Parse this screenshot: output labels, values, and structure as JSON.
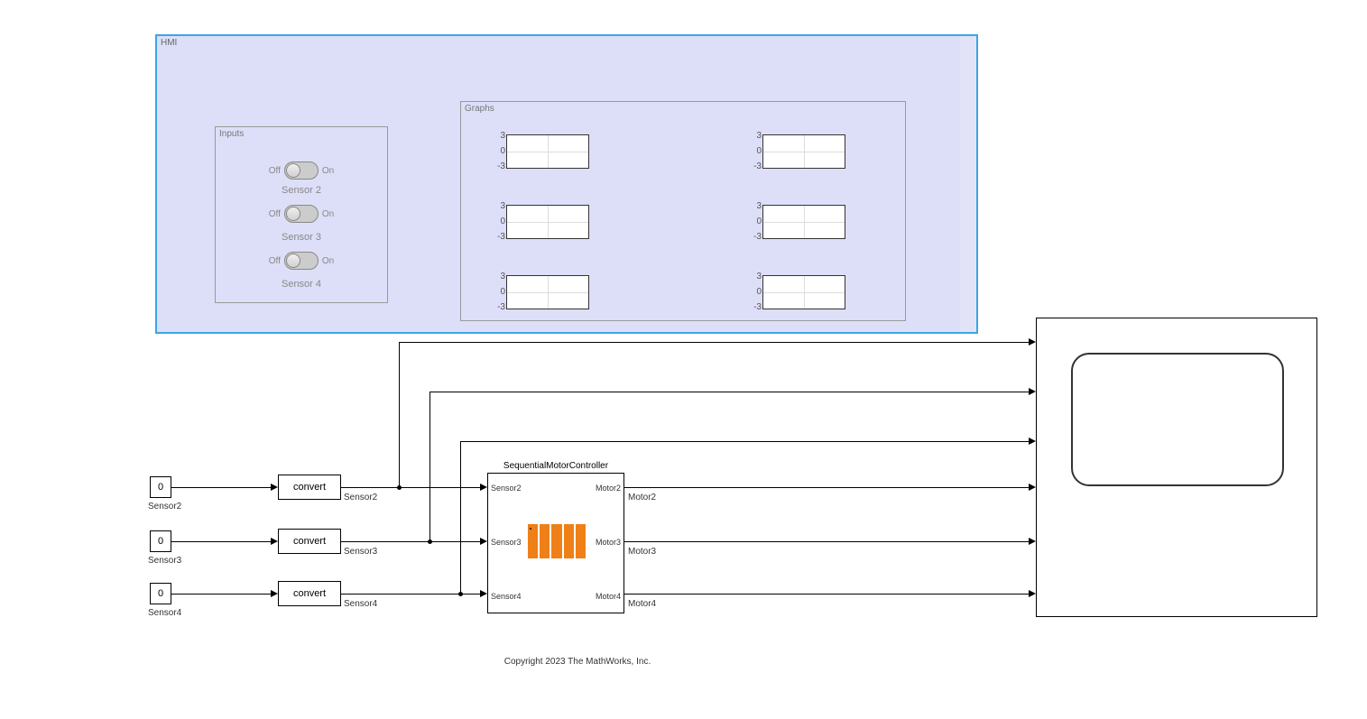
{
  "hmi": {
    "title": "HMI",
    "inputs": {
      "title": "Inputs",
      "off_label": "Off",
      "on_label": "On",
      "sensors": [
        "Sensor 2",
        "Sensor 3",
        "Sensor 4"
      ]
    },
    "graphs": {
      "title": "Graphs",
      "ticks": [
        "3",
        "0",
        "-3"
      ]
    }
  },
  "constants": {
    "value": "0",
    "labels": [
      "Sensor2",
      "Sensor3",
      "Sensor4"
    ]
  },
  "converts": {
    "label": "convert",
    "out_labels": [
      "Sensor2",
      "Sensor3",
      "Sensor4"
    ]
  },
  "controller": {
    "title": "SequentialMotorController",
    "inputs": [
      "Sensor2",
      "Sensor3",
      "Sensor4"
    ],
    "outputs": [
      "Motor2",
      "Motor3",
      "Motor4"
    ],
    "out_signals": [
      "Motor2",
      "Motor3",
      "Motor4"
    ]
  },
  "copyright": "Copyright 2023 The MathWorks, Inc."
}
